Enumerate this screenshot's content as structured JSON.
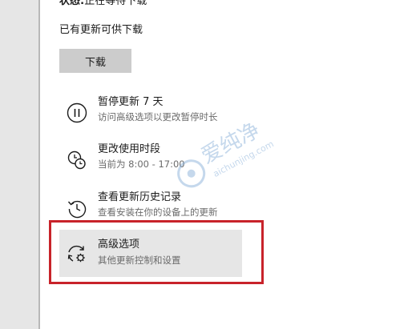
{
  "status": {
    "label": "状态:",
    "value": "正在等待下载"
  },
  "update_available": "已有更新可供下载",
  "download_button": "下载",
  "options": [
    {
      "icon": "pause-icon",
      "title": "暂停更新 7 天",
      "subtitle": "访问高级选项以更改暂停时长"
    },
    {
      "icon": "clock-icon",
      "title": "更改使用时段",
      "subtitle": "当前为 8:00 - 17:00"
    },
    {
      "icon": "history-icon",
      "title": "查看更新历史记录",
      "subtitle": "查看安装在你的设备上的更新"
    },
    {
      "icon": "sync-gear-icon",
      "title": "高级选项",
      "subtitle": "其他更新控制和设置"
    }
  ],
  "watermark": {
    "brand": "爱纯净",
    "url": "aichunjing.com"
  },
  "colors": {
    "highlight": "#c8232a",
    "button": "#cccccc",
    "hover": "#e6e6e6"
  }
}
